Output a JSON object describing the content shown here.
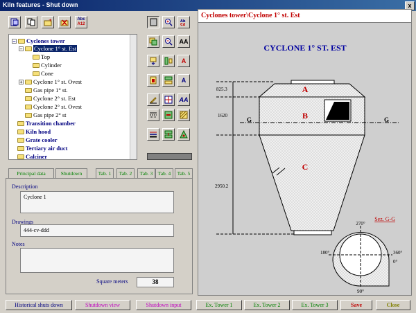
{
  "window": {
    "title": "Kiln features - Shut down",
    "close_glyph": "x"
  },
  "toolbar": {
    "abc_label": "Abc",
    "abc_sub": "A12"
  },
  "side_toolbar": {
    "aa_labels": [
      "AA",
      "A",
      "A",
      "AA"
    ]
  },
  "tree": {
    "root": "Cyclones tower",
    "selected": "Cyclone 1° st. Est",
    "children_of_selected": [
      "Top",
      "Cylinder",
      "Cone"
    ],
    "siblings": [
      "Cyclone 1° st. Ovest",
      "Gas pipe 1° st.",
      "Cyclone 2° st. Est",
      "Cyclone 2° st. Ovest",
      "Gas pipe 2° st"
    ],
    "top_level": [
      "Transition chamber",
      "Kiln hood",
      "Grate cooler",
      "Tertiary air duct",
      "Calciner"
    ]
  },
  "tabs": [
    "Principal data",
    "Shutdown",
    "Tab. 1",
    "Tab. 2",
    "Tab. 3",
    "Tab. 4",
    "Tab. 5"
  ],
  "form": {
    "description_label": "Description",
    "description_value": "Cyclone 1",
    "drawings_label": "Drawings",
    "drawings_value": "444-cv-ddd",
    "notes_label": "Notes",
    "notes_value": "",
    "square_meters_label": "Square meters",
    "square_meters_value": "38"
  },
  "bottom_buttons": [
    {
      "label": "Historical shuts down",
      "color": "#000080"
    },
    {
      "label": "Shutdown view",
      "color": "#c000c0"
    },
    {
      "label": "Shutdown input",
      "color": "#c000c0"
    },
    {
      "label": "Ex. Tower 1",
      "color": "#008000"
    },
    {
      "label": "Ex. Tower 2",
      "color": "#008000"
    },
    {
      "label": "Ex. Tower 3",
      "color": "#008000"
    },
    {
      "label": "Save",
      "color": "#c00000"
    },
    {
      "label": "Close",
      "color": "#808000"
    }
  ],
  "drawing": {
    "breadcrumb": "Cyclones tower\\Cyclone 1° st. Est",
    "title": "CYCLONE 1° ST. EST",
    "dims": [
      "825.3",
      "1620",
      "2950.2"
    ],
    "section_letters": [
      "A",
      "B",
      "C"
    ],
    "section_marker": "G",
    "section_label": "Sez. G-G",
    "angles": [
      "270°",
      "180°",
      "360°",
      "0°",
      "90°"
    ]
  }
}
